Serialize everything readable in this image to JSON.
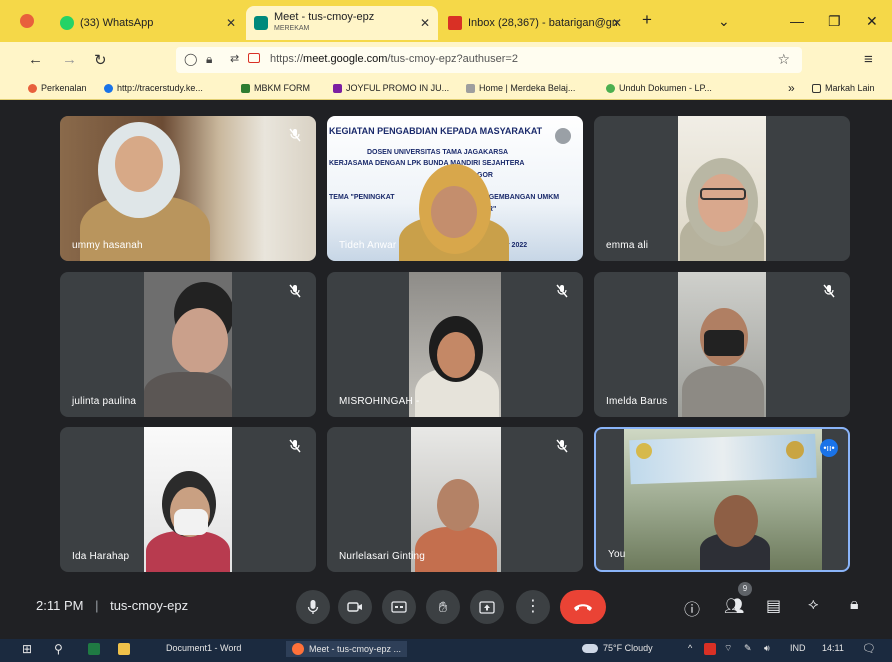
{
  "browser": {
    "tabs": [
      {
        "label": "(33) WhatsApp",
        "sublabel": ""
      },
      {
        "label": "Meet - tus-cmoy-epz",
        "sublabel": "MEREKAM"
      },
      {
        "label": "Inbox (28,367) - batarigan@gm",
        "sublabel": ""
      }
    ],
    "url": {
      "prefix": "https://",
      "host": "meet.google.com",
      "path": "/tus-cmoy-epz?authuser=2"
    },
    "bookmarks": [
      "Perkenalan",
      "http://tracerstudy.ke...",
      "MBKM FORM",
      "JOYFUL PROMO IN JU...",
      "Home | Merdeka Belaj...",
      "Unduh Dokumen - LP...",
      "Markah Lain"
    ]
  },
  "meet": {
    "presentation": {
      "line1": "KEGIATAN PENGABDIAN KEPADA MASYARAKAT",
      "line2": "DOSEN UNIVERSITAS TAMA JAGAKARSA",
      "line3": "KERJASAMA DENGAN LPK BUNDA MANDIRI SEJAHTERA",
      "line4": "GOR",
      "line5": "TEMA \"PENINGKAT",
      "line6": "ENGEMBANGAN UMKM",
      "line7": "GOR\"",
      "line8": "er 2022"
    },
    "participants": [
      {
        "name": "ummy hasanah"
      },
      {
        "name": "Tideh Anwar"
      },
      {
        "name": "emma ali"
      },
      {
        "name": "julinta paulina"
      },
      {
        "name": "MISROHINGAH -"
      },
      {
        "name": "Imelda Barus"
      },
      {
        "name": "Ida Harahap"
      },
      {
        "name": "Nurlelasari Ginting"
      },
      {
        "name": "You"
      }
    ],
    "controls": {
      "time": "2:11 PM",
      "separator": "|",
      "meeting_code": "tus-cmoy-epz",
      "people_count": "9"
    }
  },
  "taskbar": {
    "items": [
      "Document1 - Word",
      "Meet - tus-cmoy-epz ..."
    ],
    "weather": "75°F  Cloudy",
    "lang": "IND",
    "time": "14:11"
  },
  "colors": {
    "tabbar": "#f5d848",
    "meet_bg": "#202124",
    "tile_bg": "#3c4043",
    "end_call": "#ea4335",
    "speaking_border": "#8ab4f8"
  }
}
